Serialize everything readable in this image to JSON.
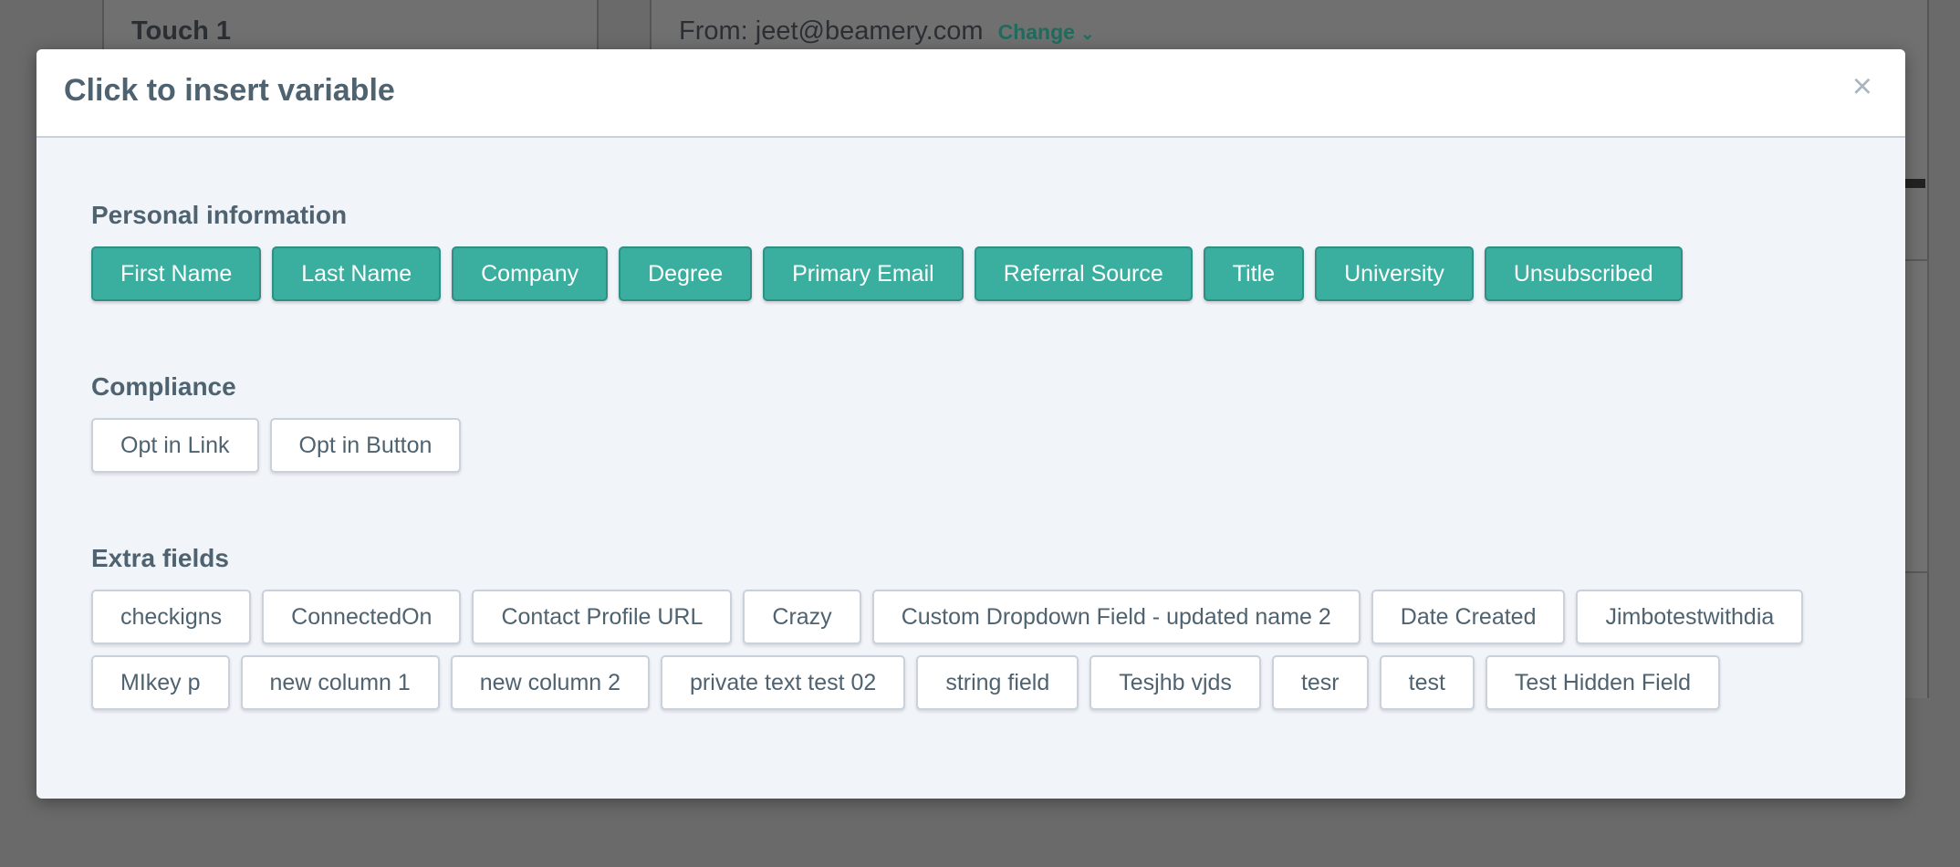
{
  "background": {
    "left_title": "Touch 1",
    "from_text": "From: jeet@beamery.com",
    "change_label": "Change",
    "change_icon": "chevron-down-icon"
  },
  "modal": {
    "title": "Click to insert variable",
    "close_icon": "×",
    "sections": [
      {
        "title": "Personal information",
        "style": "teal",
        "items": [
          "First Name",
          "Last Name",
          "Company",
          "Degree",
          "Primary Email",
          "Referral Source",
          "Title",
          "University",
          "Unsubscribed"
        ]
      },
      {
        "title": "Compliance",
        "style": "white",
        "items": [
          "Opt in Link",
          "Opt in Button"
        ]
      },
      {
        "title": "Extra fields",
        "style": "white",
        "items": [
          "checkigns",
          "ConnectedOn",
          "Contact Profile URL",
          "Crazy",
          "Custom Dropdown Field - updated name 2",
          "Date Created",
          "Jimbotestwithdia",
          "MIkey p",
          "new column 1",
          "new column 2",
          "private text test 02",
          "string field",
          "Tesjhb vjds",
          "tesr",
          "test",
          "Test Hidden Field"
        ]
      }
    ]
  },
  "colors": {
    "teal": "#3aaf9f",
    "text": "#4e6270",
    "overlay": "#686868"
  }
}
